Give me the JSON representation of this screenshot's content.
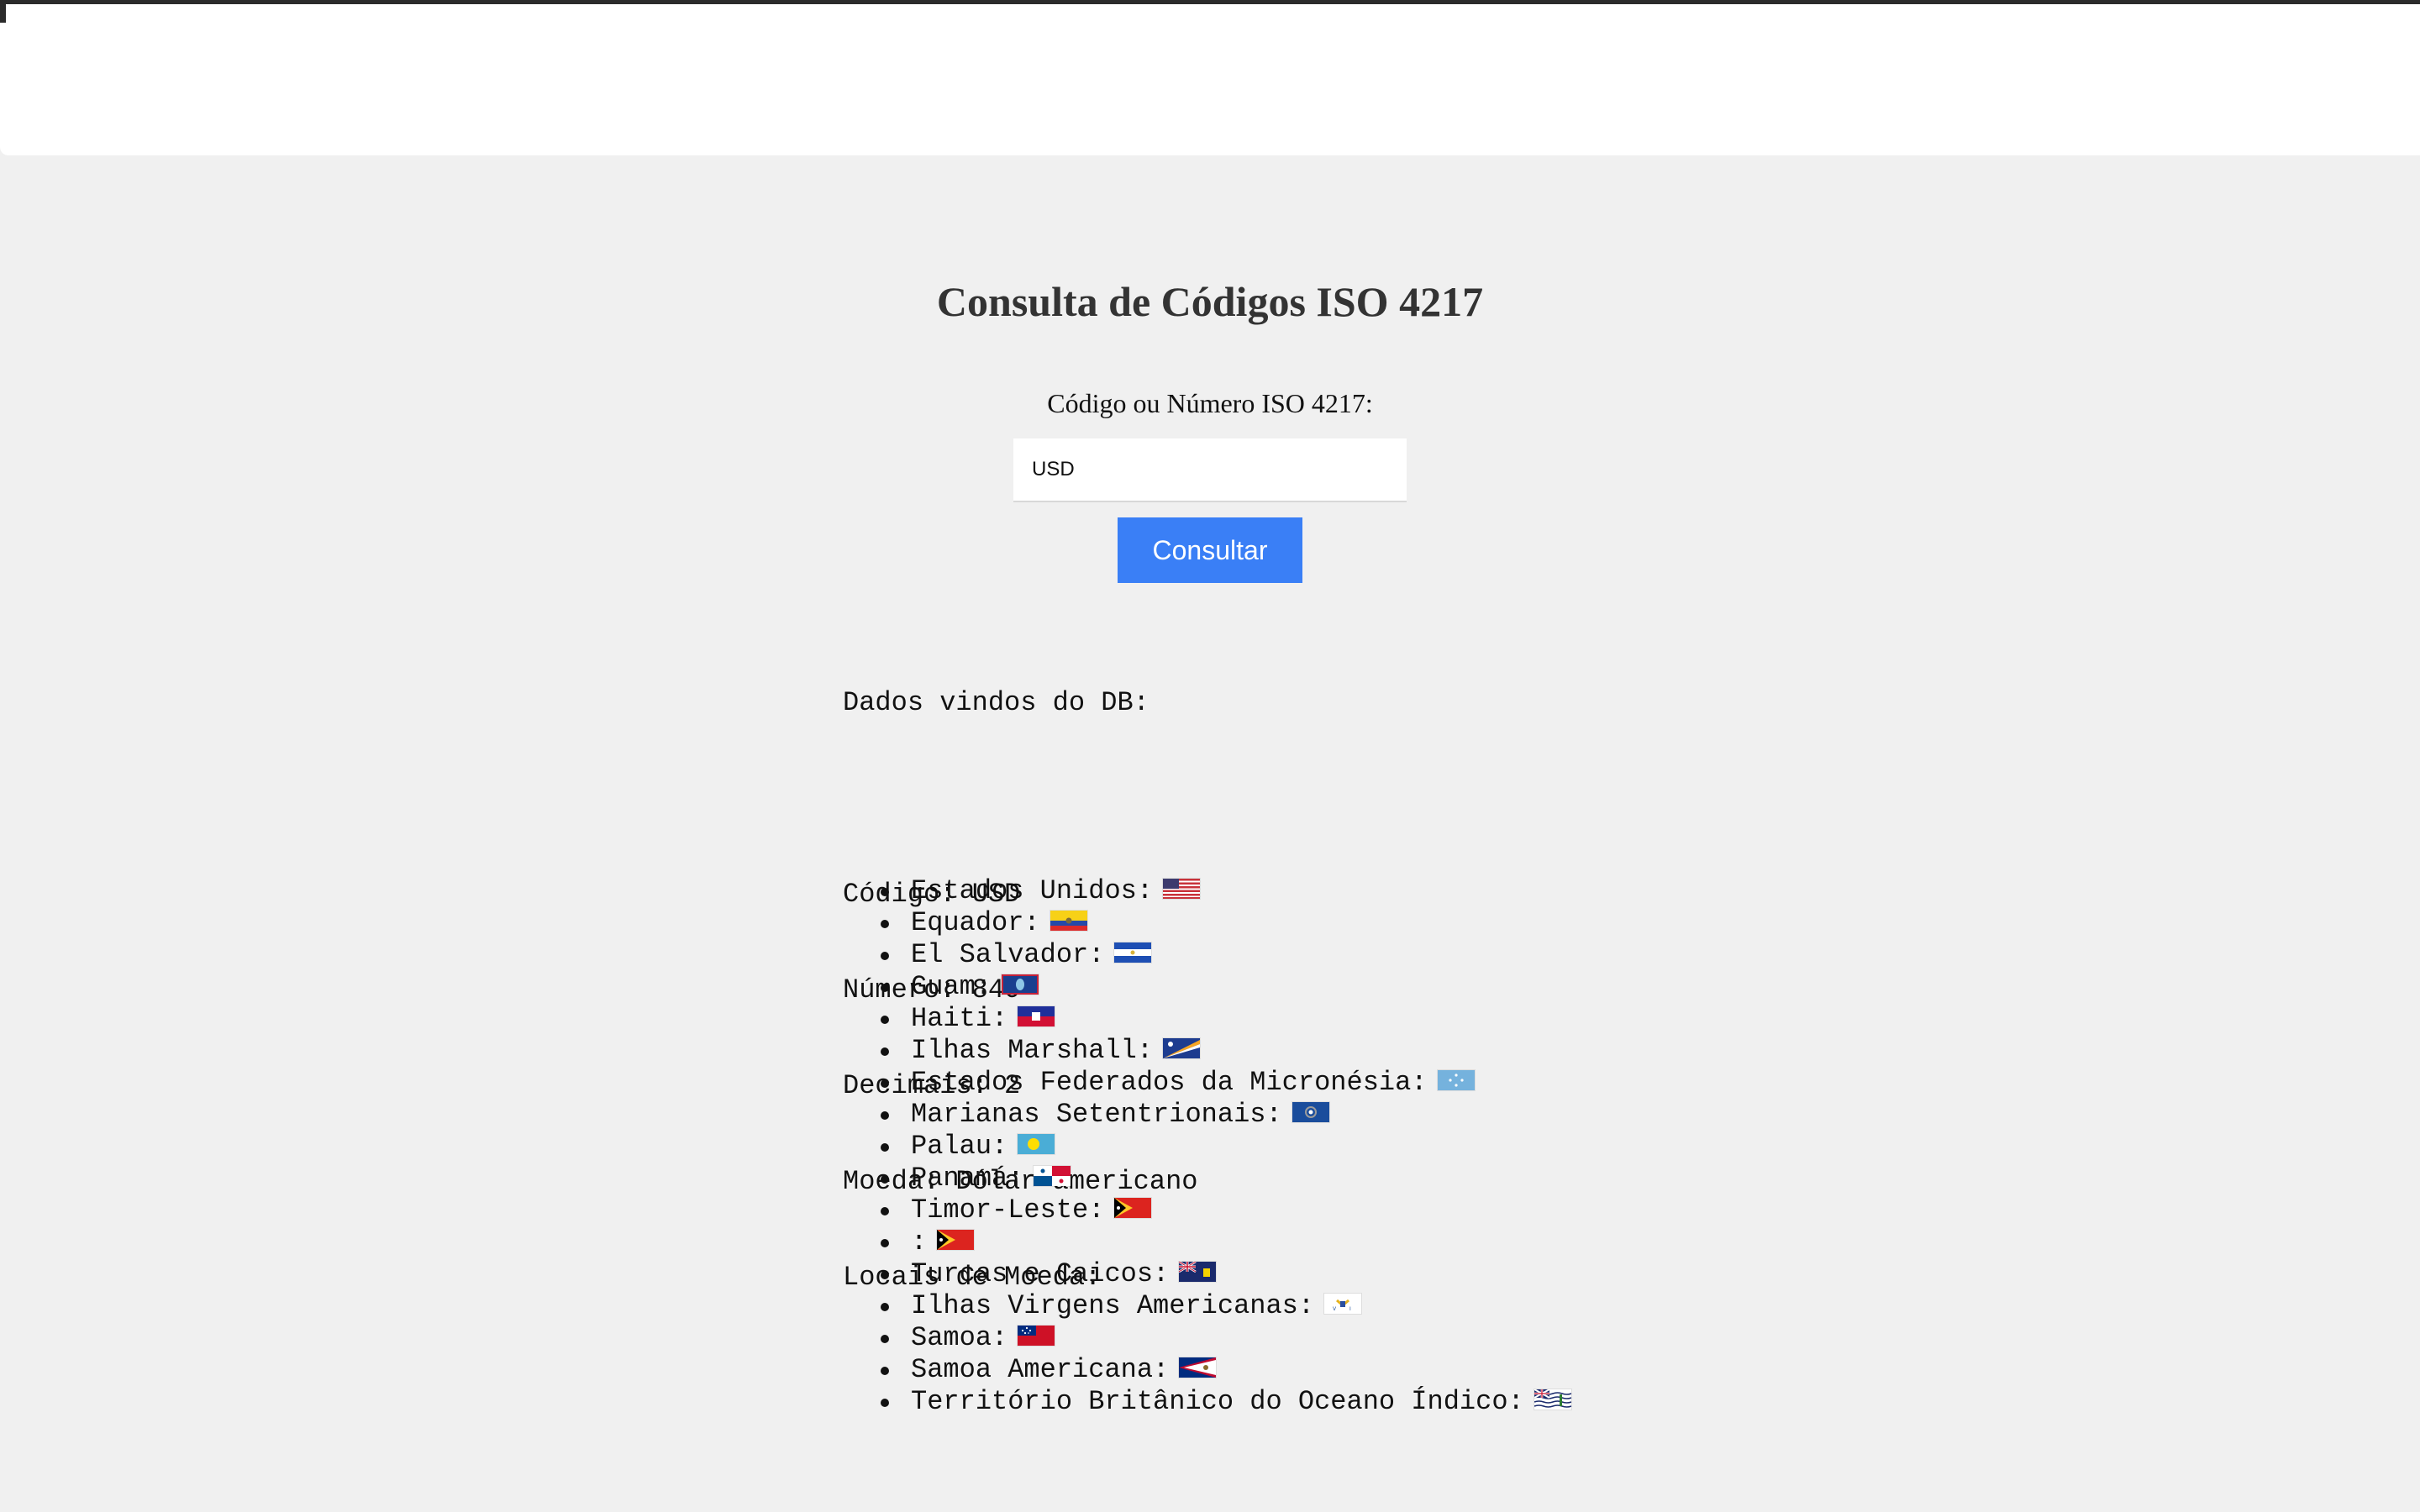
{
  "page": {
    "title": "Consulta de Códigos ISO 4217"
  },
  "form": {
    "label": "Código ou Número ISO 4217:",
    "input_value": "USD",
    "submit_label": "Consultar"
  },
  "result": {
    "header": "Dados vindos do DB:",
    "code_line": "Código: USD",
    "number_line": "Número: 840",
    "decimals_line": "Decimais: 2",
    "currency_line": "Moeda: Dólar americano",
    "places_line": "Locais de Moeda:",
    "places": [
      {
        "label": "Estados Unidos:",
        "flag": "us-flag-icon"
      },
      {
        "label": "Equador:",
        "flag": "ecuador-flag-icon"
      },
      {
        "label": "El Salvador:",
        "flag": "el-salvador-flag-icon"
      },
      {
        "label": "Guam:",
        "flag": "guam-flag-icon"
      },
      {
        "label": "Haiti:",
        "flag": "haiti-flag-icon"
      },
      {
        "label": "Ilhas Marshall:",
        "flag": "marshall-islands-flag-icon"
      },
      {
        "label": "Estados Federados da Micronésia:",
        "flag": "micronesia-flag-icon"
      },
      {
        "label": "Marianas Setentrionais:",
        "flag": "northern-mariana-flag-icon"
      },
      {
        "label": "Palau:",
        "flag": "palau-flag-icon"
      },
      {
        "label": "Panamá:",
        "flag": "panama-flag-icon"
      },
      {
        "label": "Timor-Leste:",
        "flag": "timor-leste-flag-icon"
      },
      {
        "label": ":",
        "flag": "timor-leste-flag-icon"
      },
      {
        "label": "Turcas e Caicos:",
        "flag": "turks-caicos-flag-icon"
      },
      {
        "label": "Ilhas Virgens Americanas:",
        "flag": "us-virgin-islands-flag-icon"
      },
      {
        "label": "Samoa:",
        "flag": "samoa-flag-icon"
      },
      {
        "label": "Samoa Americana:",
        "flag": "american-samoa-flag-icon"
      },
      {
        "label": "Território Britânico do Oceano Índico:",
        "flag": "british-indian-ocean-flag-icon"
      }
    ]
  }
}
